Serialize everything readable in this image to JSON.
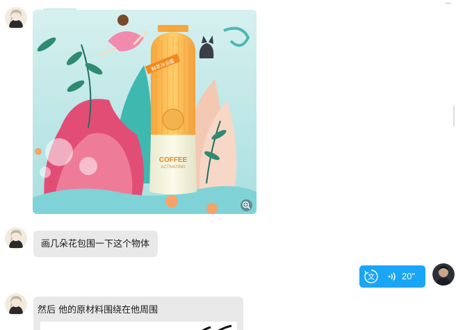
{
  "messages": [
    {
      "sender": "other",
      "type": "image",
      "image": {
        "bottle_label_title": "COFFEE",
        "bottle_label_subtitle": "ACTIVATING",
        "ribbon_text": "鲜萃沐浴露"
      }
    },
    {
      "sender": "other",
      "type": "text",
      "text": "画几朵花包围一下这个物体"
    },
    {
      "sender": "self",
      "type": "voice",
      "duration": "20\""
    },
    {
      "sender": "other",
      "type": "text",
      "text": "然后 他的原材料围绕在他周围"
    }
  ],
  "colors": {
    "bubble_other": "#e9e9e9",
    "bubble_voice": "#1aa5f5",
    "background": "#ffffff"
  },
  "icons": {
    "zoom": "zoom-in-icon",
    "translate": "translate-icon",
    "voice_wave": "sound-wave-icon"
  }
}
